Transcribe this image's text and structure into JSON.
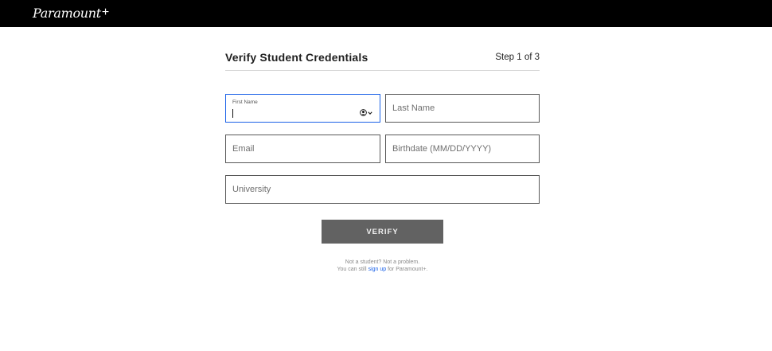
{
  "brand": {
    "logo_text": "Paramount",
    "logo_plus": "+"
  },
  "header": {
    "title": "Verify Student Credentials",
    "step": "Step 1 of 3"
  },
  "form": {
    "first_name": {
      "label": "First Name",
      "value": ""
    },
    "last_name": {
      "placeholder": "Last Name"
    },
    "email": {
      "placeholder": "Email"
    },
    "birthdate": {
      "placeholder": "Birthdate (MM/DD/YYYY)"
    },
    "university": {
      "placeholder": "University"
    },
    "submit_label": "VERIFY"
  },
  "footer": {
    "line1": "Not a student? Not a problem.",
    "line2_prefix": "You can still",
    "line2_link": "sign up",
    "line2_suffix": "for Paramount+."
  },
  "colors": {
    "topbar": "#000000",
    "button": "#626262",
    "focus_border": "#1b62e8",
    "link": "#1b62e8"
  },
  "icons": {
    "autofill": "person-circle-icon",
    "autofill_dropdown": "chevron-down-icon"
  }
}
